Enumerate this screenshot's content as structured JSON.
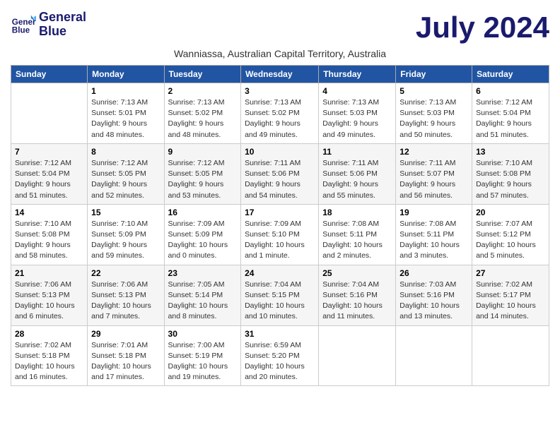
{
  "logo": {
    "line1": "General",
    "line2": "Blue"
  },
  "title": "July 2024",
  "subtitle": "Wanniassa, Australian Capital Territory, Australia",
  "days_of_week": [
    "Sunday",
    "Monday",
    "Tuesday",
    "Wednesday",
    "Thursday",
    "Friday",
    "Saturday"
  ],
  "weeks": [
    [
      {
        "day": "",
        "info": ""
      },
      {
        "day": "1",
        "info": "Sunrise: 7:13 AM\nSunset: 5:01 PM\nDaylight: 9 hours\nand 48 minutes."
      },
      {
        "day": "2",
        "info": "Sunrise: 7:13 AM\nSunset: 5:02 PM\nDaylight: 9 hours\nand 48 minutes."
      },
      {
        "day": "3",
        "info": "Sunrise: 7:13 AM\nSunset: 5:02 PM\nDaylight: 9 hours\nand 49 minutes."
      },
      {
        "day": "4",
        "info": "Sunrise: 7:13 AM\nSunset: 5:03 PM\nDaylight: 9 hours\nand 49 minutes."
      },
      {
        "day": "5",
        "info": "Sunrise: 7:13 AM\nSunset: 5:03 PM\nDaylight: 9 hours\nand 50 minutes."
      },
      {
        "day": "6",
        "info": "Sunrise: 7:12 AM\nSunset: 5:04 PM\nDaylight: 9 hours\nand 51 minutes."
      }
    ],
    [
      {
        "day": "7",
        "info": "Sunrise: 7:12 AM\nSunset: 5:04 PM\nDaylight: 9 hours\nand 51 minutes."
      },
      {
        "day": "8",
        "info": "Sunrise: 7:12 AM\nSunset: 5:05 PM\nDaylight: 9 hours\nand 52 minutes."
      },
      {
        "day": "9",
        "info": "Sunrise: 7:12 AM\nSunset: 5:05 PM\nDaylight: 9 hours\nand 53 minutes."
      },
      {
        "day": "10",
        "info": "Sunrise: 7:11 AM\nSunset: 5:06 PM\nDaylight: 9 hours\nand 54 minutes."
      },
      {
        "day": "11",
        "info": "Sunrise: 7:11 AM\nSunset: 5:06 PM\nDaylight: 9 hours\nand 55 minutes."
      },
      {
        "day": "12",
        "info": "Sunrise: 7:11 AM\nSunset: 5:07 PM\nDaylight: 9 hours\nand 56 minutes."
      },
      {
        "day": "13",
        "info": "Sunrise: 7:10 AM\nSunset: 5:08 PM\nDaylight: 9 hours\nand 57 minutes."
      }
    ],
    [
      {
        "day": "14",
        "info": "Sunrise: 7:10 AM\nSunset: 5:08 PM\nDaylight: 9 hours\nand 58 minutes."
      },
      {
        "day": "15",
        "info": "Sunrise: 7:10 AM\nSunset: 5:09 PM\nDaylight: 9 hours\nand 59 minutes."
      },
      {
        "day": "16",
        "info": "Sunrise: 7:09 AM\nSunset: 5:09 PM\nDaylight: 10 hours\nand 0 minutes."
      },
      {
        "day": "17",
        "info": "Sunrise: 7:09 AM\nSunset: 5:10 PM\nDaylight: 10 hours\nand 1 minute."
      },
      {
        "day": "18",
        "info": "Sunrise: 7:08 AM\nSunset: 5:11 PM\nDaylight: 10 hours\nand 2 minutes."
      },
      {
        "day": "19",
        "info": "Sunrise: 7:08 AM\nSunset: 5:11 PM\nDaylight: 10 hours\nand 3 minutes."
      },
      {
        "day": "20",
        "info": "Sunrise: 7:07 AM\nSunset: 5:12 PM\nDaylight: 10 hours\nand 5 minutes."
      }
    ],
    [
      {
        "day": "21",
        "info": "Sunrise: 7:06 AM\nSunset: 5:13 PM\nDaylight: 10 hours\nand 6 minutes."
      },
      {
        "day": "22",
        "info": "Sunrise: 7:06 AM\nSunset: 5:13 PM\nDaylight: 10 hours\nand 7 minutes."
      },
      {
        "day": "23",
        "info": "Sunrise: 7:05 AM\nSunset: 5:14 PM\nDaylight: 10 hours\nand 8 minutes."
      },
      {
        "day": "24",
        "info": "Sunrise: 7:04 AM\nSunset: 5:15 PM\nDaylight: 10 hours\nand 10 minutes."
      },
      {
        "day": "25",
        "info": "Sunrise: 7:04 AM\nSunset: 5:16 PM\nDaylight: 10 hours\nand 11 minutes."
      },
      {
        "day": "26",
        "info": "Sunrise: 7:03 AM\nSunset: 5:16 PM\nDaylight: 10 hours\nand 13 minutes."
      },
      {
        "day": "27",
        "info": "Sunrise: 7:02 AM\nSunset: 5:17 PM\nDaylight: 10 hours\nand 14 minutes."
      }
    ],
    [
      {
        "day": "28",
        "info": "Sunrise: 7:02 AM\nSunset: 5:18 PM\nDaylight: 10 hours\nand 16 minutes."
      },
      {
        "day": "29",
        "info": "Sunrise: 7:01 AM\nSunset: 5:18 PM\nDaylight: 10 hours\nand 17 minutes."
      },
      {
        "day": "30",
        "info": "Sunrise: 7:00 AM\nSunset: 5:19 PM\nDaylight: 10 hours\nand 19 minutes."
      },
      {
        "day": "31",
        "info": "Sunrise: 6:59 AM\nSunset: 5:20 PM\nDaylight: 10 hours\nand 20 minutes."
      },
      {
        "day": "",
        "info": ""
      },
      {
        "day": "",
        "info": ""
      },
      {
        "day": "",
        "info": ""
      }
    ]
  ]
}
